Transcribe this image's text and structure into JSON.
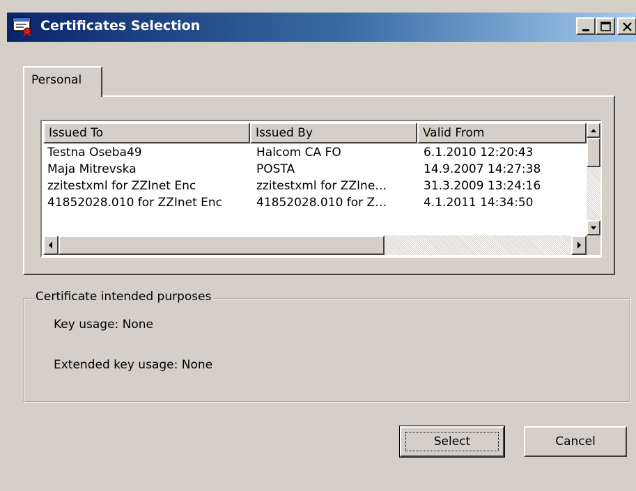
{
  "window": {
    "title": "Certificates Selection",
    "controls": {
      "minimize": "minimize",
      "maximize": "maximize",
      "close": "close"
    }
  },
  "tabs": [
    {
      "label": "Personal",
      "selected": true
    }
  ],
  "list": {
    "columns": [
      "Issued To",
      "Issued By",
      "Valid From"
    ],
    "rows": [
      [
        "Testna Oseba49",
        "Halcom CA FO",
        "6.1.2010 12:20:43"
      ],
      [
        "Maja Mitrevska",
        "POSTA",
        "14.9.2007 14:27:38"
      ],
      [
        "zzitestxml for ZZInet Enc",
        "zzitestxml for ZZIne…",
        "31.3.2009 13:24:16"
      ],
      [
        "41852028.010 for ZZInet Enc",
        "41852028.010 for Z…",
        "4.1.2011 14:34:50"
      ]
    ]
  },
  "purposes": {
    "legend": "Certificate intended purposes",
    "key_usage": "Key usage: None",
    "extended_key_usage": "Extended key usage: None"
  },
  "buttons": {
    "select": "Select",
    "cancel": "Cancel"
  }
}
